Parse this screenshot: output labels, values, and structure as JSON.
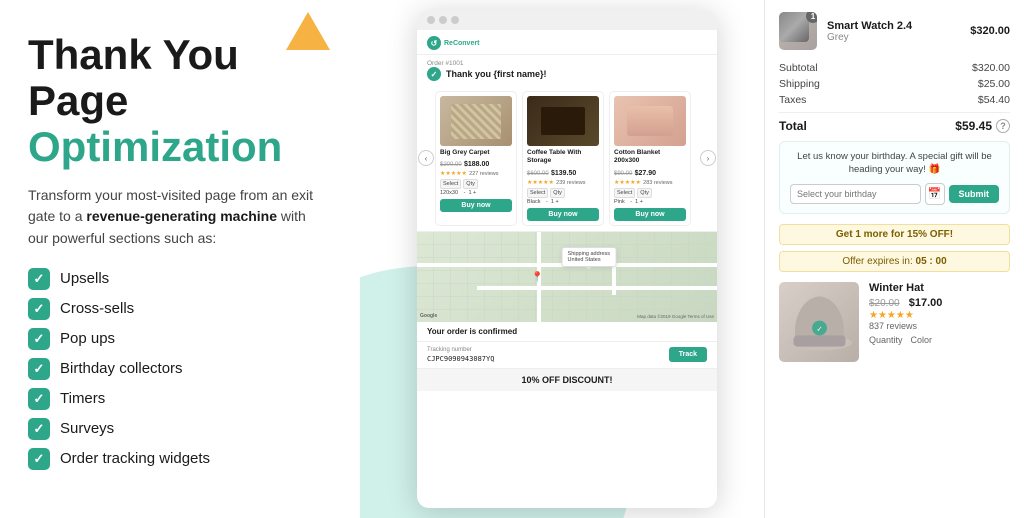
{
  "left": {
    "title_line1": "Thank You Page",
    "title_line2": "Optimization",
    "description_prefix": "Transform your most-visited page from an exit gate to a ",
    "description_bold": "revenue-generating machine",
    "description_suffix": " with our powerful sections such as:",
    "features": [
      "Upsells",
      "Cross-sells",
      "Pop ups",
      "Birthday collectors",
      "Timers",
      "Surveys",
      "Order tracking widgets"
    ]
  },
  "phone": {
    "logo_text": "ReConvert",
    "order_number": "Order #1001",
    "thank_you_text": "Thank you {first name}!",
    "products": [
      {
        "name": "Big Grey Carpet",
        "price_old": "$200.00",
        "price_new": "$188.00",
        "stars": "★★★★★",
        "reviews": "227 reviews",
        "option": "120x30",
        "qty": "1"
      },
      {
        "name": "Coffee Table With Storage",
        "price_old": "$600.00",
        "price_new": "$139.50",
        "stars": "★★★★★",
        "reviews": "239 reviews",
        "option": "Black",
        "qty": "1"
      },
      {
        "name": "Cotton Blanket 200x300",
        "price_old": "$90.00",
        "price_new": "$27.90",
        "stars": "★★★★★",
        "reviews": "283 reviews",
        "option": "Pink",
        "qty": "1"
      }
    ],
    "map_tooltip_line1": "Shipping address",
    "map_tooltip_line2": "United States",
    "google_text": "Google",
    "map_data": "Map data ©2019 Google  Terms of Use",
    "order_confirmed": "Your order is confirmed",
    "tracking_label": "Tracking number",
    "tracking_number": "CJPC9090943087YQ",
    "track_btn": "Track",
    "discount_banner": "10% OFF DISCOUNT!"
  },
  "right": {
    "order_item_name": "Smart Watch 2.4",
    "order_item_variant": "Grey",
    "order_item_price": "$320.00",
    "order_item_badge": "1",
    "subtotal_label": "Subtotal",
    "subtotal_value": "$320.00",
    "shipping_label": "Shipping",
    "shipping_value": "$25.00",
    "taxes_label": "Taxes",
    "taxes_value": "$54.40",
    "total_label": "Total",
    "total_value": "$59.45",
    "birthday_text": "Let us know your birthday. A special gift will be heading your way! 🎁",
    "birthday_placeholder": "Select your birthday",
    "birthday_submit": "Submit",
    "upsell_text": "Get 1 more for 15% OFF!",
    "timer_label": "Offer expires in:",
    "timer_value": "05 : 00",
    "hat_name": "Winter Hat",
    "hat_price_old": "$20.00",
    "hat_price_new": "$17.00",
    "hat_stars": "★★★★★",
    "hat_reviews": "837 reviews",
    "hat_option1": "Quantity",
    "hat_option2": "Color"
  }
}
